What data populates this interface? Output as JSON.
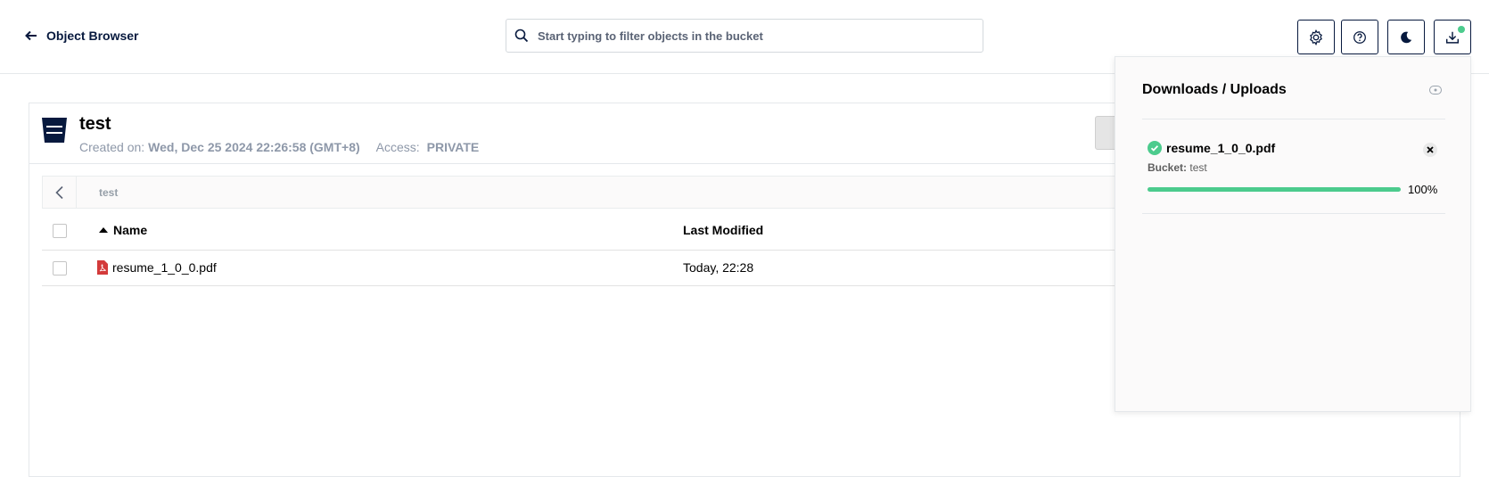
{
  "header": {
    "back_label": "Object Browser",
    "search_placeholder": "Start typing to filter objects in the bucket",
    "buttons": [
      "settings",
      "help",
      "theme-toggle",
      "downloads-uploads"
    ]
  },
  "bucket": {
    "name": "test",
    "created_label": "Created on:",
    "created_value": "Wed, Dec 25 2024 22:26:58 (GMT+8)",
    "access_label": "Access:",
    "access_value": "PRIVATE"
  },
  "breadcrumb": {
    "path": "test"
  },
  "table": {
    "columns": [
      "Name",
      "Last Modified"
    ],
    "rows": [
      {
        "name": "resume_1_0_0.pdf",
        "last_modified": "Today, 22:28"
      }
    ]
  },
  "panel": {
    "title": "Downloads / Uploads",
    "items": [
      {
        "name": "resume_1_0_0.pdf",
        "bucket_label": "Bucket:",
        "bucket": "test",
        "progress": 100,
        "progress_label": "100%"
      }
    ]
  },
  "colors": {
    "accent": "#4ccb8d",
    "primary": "#07193e"
  }
}
